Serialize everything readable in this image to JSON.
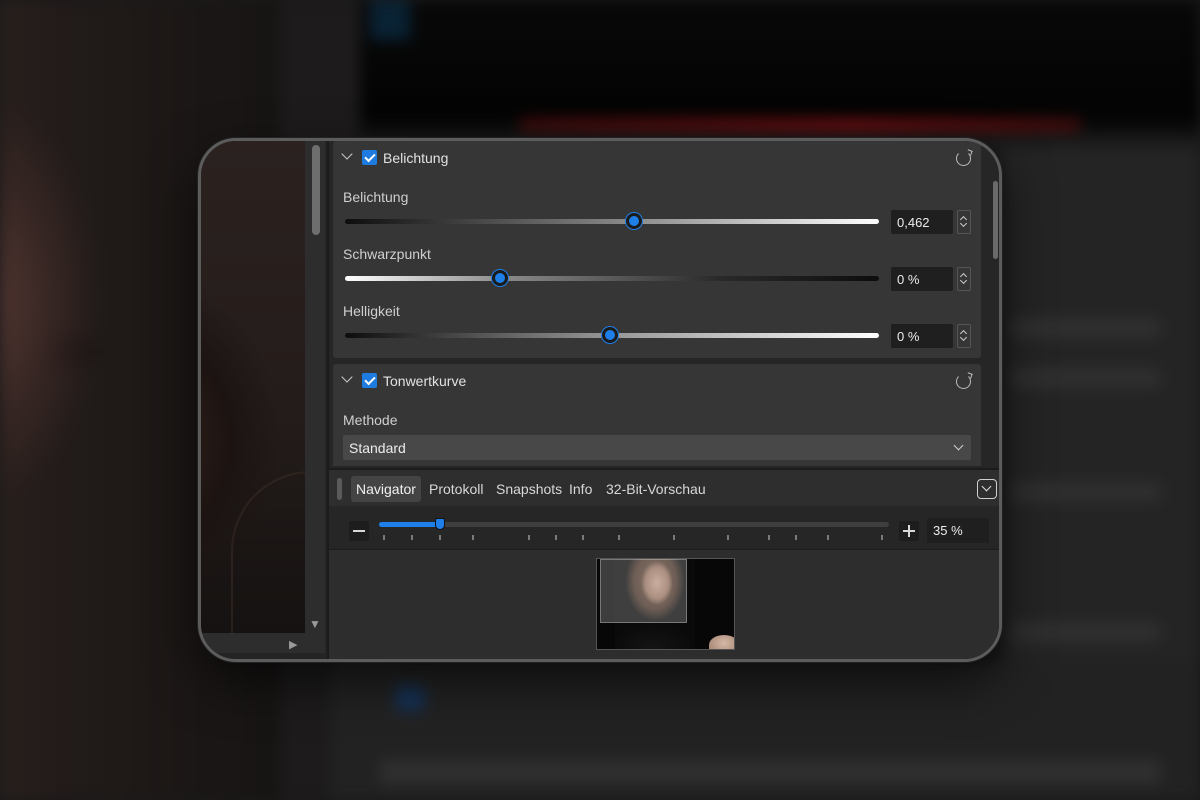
{
  "exposure_section": {
    "title": "Belichtung",
    "enabled": true,
    "params": [
      {
        "label": "Belichtung",
        "value": "0,462",
        "level": 0.546
      },
      {
        "label": "Schwarzpunkt",
        "value": "0 %",
        "level": 0.295
      },
      {
        "label": "Helligkeit",
        "value": "0 %",
        "level": 0.502
      }
    ]
  },
  "tone_section": {
    "title": "Tonwertkurve",
    "enabled": true,
    "method_label": "Methode",
    "method_value": "Standard"
  },
  "tabs": [
    "Navigator",
    "Protokoll",
    "Snapshots",
    "Info",
    "32-Bit-Vorschau"
  ],
  "active_tab": "Navigator",
  "zoom": {
    "value": "35 %",
    "level": 0.12
  },
  "colors": {
    "accent": "#1f7fe8"
  },
  "icons": [
    "chevron-down-icon",
    "checkbox-checked-icon",
    "reset-icon",
    "spinner-icon",
    "minus-icon",
    "plus-icon",
    "panel-menu-icon"
  ]
}
